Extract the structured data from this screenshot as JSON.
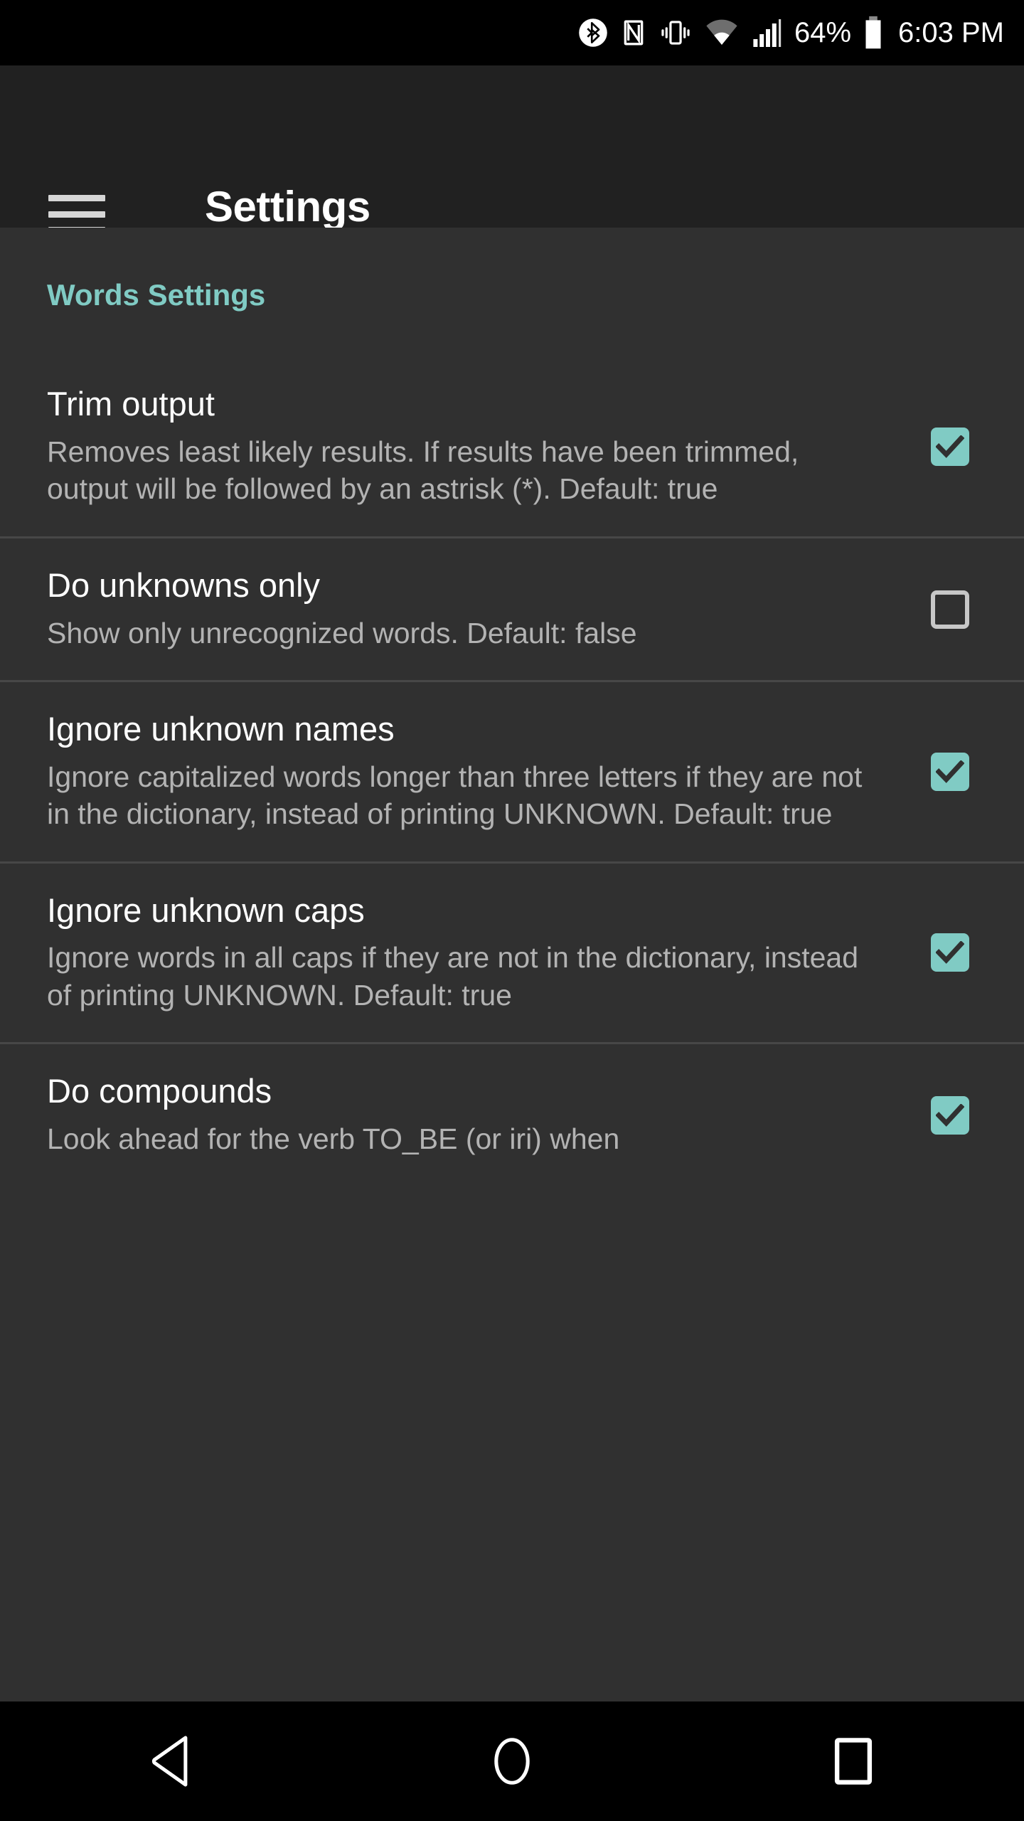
{
  "status_bar": {
    "icons": [
      "bluetooth-icon",
      "nfc-icon",
      "vibrate-icon",
      "wifi-icon",
      "cellular-signal-icon"
    ],
    "battery_percent": "64%",
    "battery_icon": "battery-icon",
    "time": "6:03 PM"
  },
  "app_bar": {
    "menu_icon": "hamburger-menu-icon",
    "title": "Settings"
  },
  "content": {
    "section_header": "Words Settings",
    "accent_color": "#80cbc4",
    "items": [
      {
        "title": "Trim output",
        "description": "Removes least likely results. If results have been trimmed, output will be followed by an astrisk (*). Default: true",
        "checked": true
      },
      {
        "title": "Do unknowns only",
        "description": "Show only unrecognized words. Default: false",
        "checked": false
      },
      {
        "title": "Ignore unknown names",
        "description": "Ignore capitalized words longer than three letters if they are not in the dictionary, instead of printing UNKNOWN. Default: true",
        "checked": true
      },
      {
        "title": "Ignore unknown caps",
        "description": "Ignore words in all caps if they are not in the dictionary, instead of printing UNKNOWN. Default: true",
        "checked": true
      },
      {
        "title": "Do compounds",
        "description": "Look ahead for the verb TO_BE (or iri) when",
        "checked": true
      }
    ]
  },
  "nav_bar": {
    "back": "back-triangle-icon",
    "home": "home-circle-icon",
    "recents": "recents-square-icon"
  }
}
